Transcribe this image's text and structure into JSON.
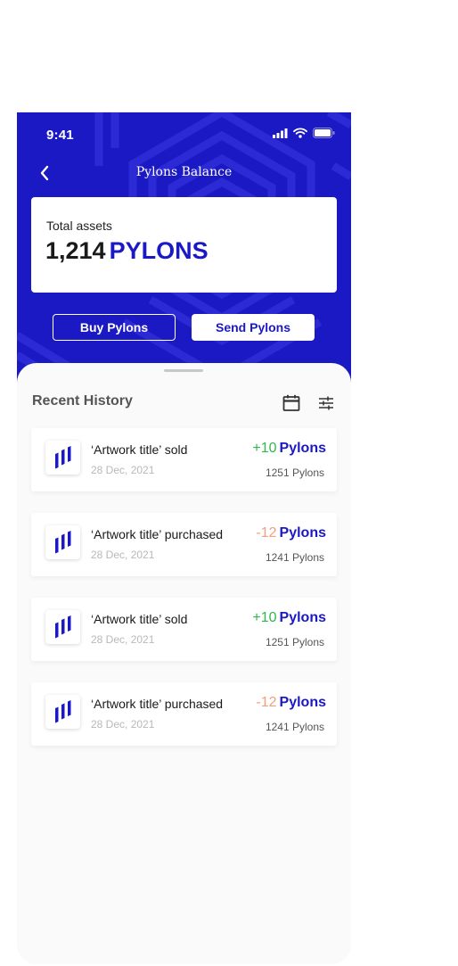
{
  "status_bar": {
    "time": "9:41"
  },
  "header": {
    "title": "Pylons Balance"
  },
  "assets": {
    "label": "Total assets",
    "amount": "1,214",
    "unit": "PYLONS"
  },
  "actions": {
    "buy_label": "Buy Pylons",
    "send_label": "Send Pylons"
  },
  "history": {
    "title": "Recent History",
    "items": [
      {
        "title": "‘Artwork title’ sold",
        "date": "28 Dec, 2021",
        "delta": "+10",
        "unit": "Pylons",
        "balance": "1251 Pylons"
      },
      {
        "title": "‘Artwork title’ purchased",
        "date": "28 Dec, 2021",
        "delta": "-12",
        "unit": "Pylons",
        "balance": "1241 Pylons"
      },
      {
        "title": "‘Artwork title’ sold",
        "date": "28 Dec, 2021",
        "delta": "+10",
        "unit": "Pylons",
        "balance": "1251 Pylons"
      },
      {
        "title": "‘Artwork title’ purchased",
        "date": "28 Dec, 2021",
        "delta": "-12",
        "unit": "Pylons",
        "balance": "1241 Pylons"
      }
    ]
  },
  "colors": {
    "brand_blue": "#1b19c4",
    "positive_green": "#31b650",
    "negative_orange": "#f0a07d"
  },
  "icons": {
    "back": "chevron-left-icon",
    "calendar": "calendar-icon",
    "filter": "sliders-icon",
    "item": "pylons-logo-icon"
  }
}
